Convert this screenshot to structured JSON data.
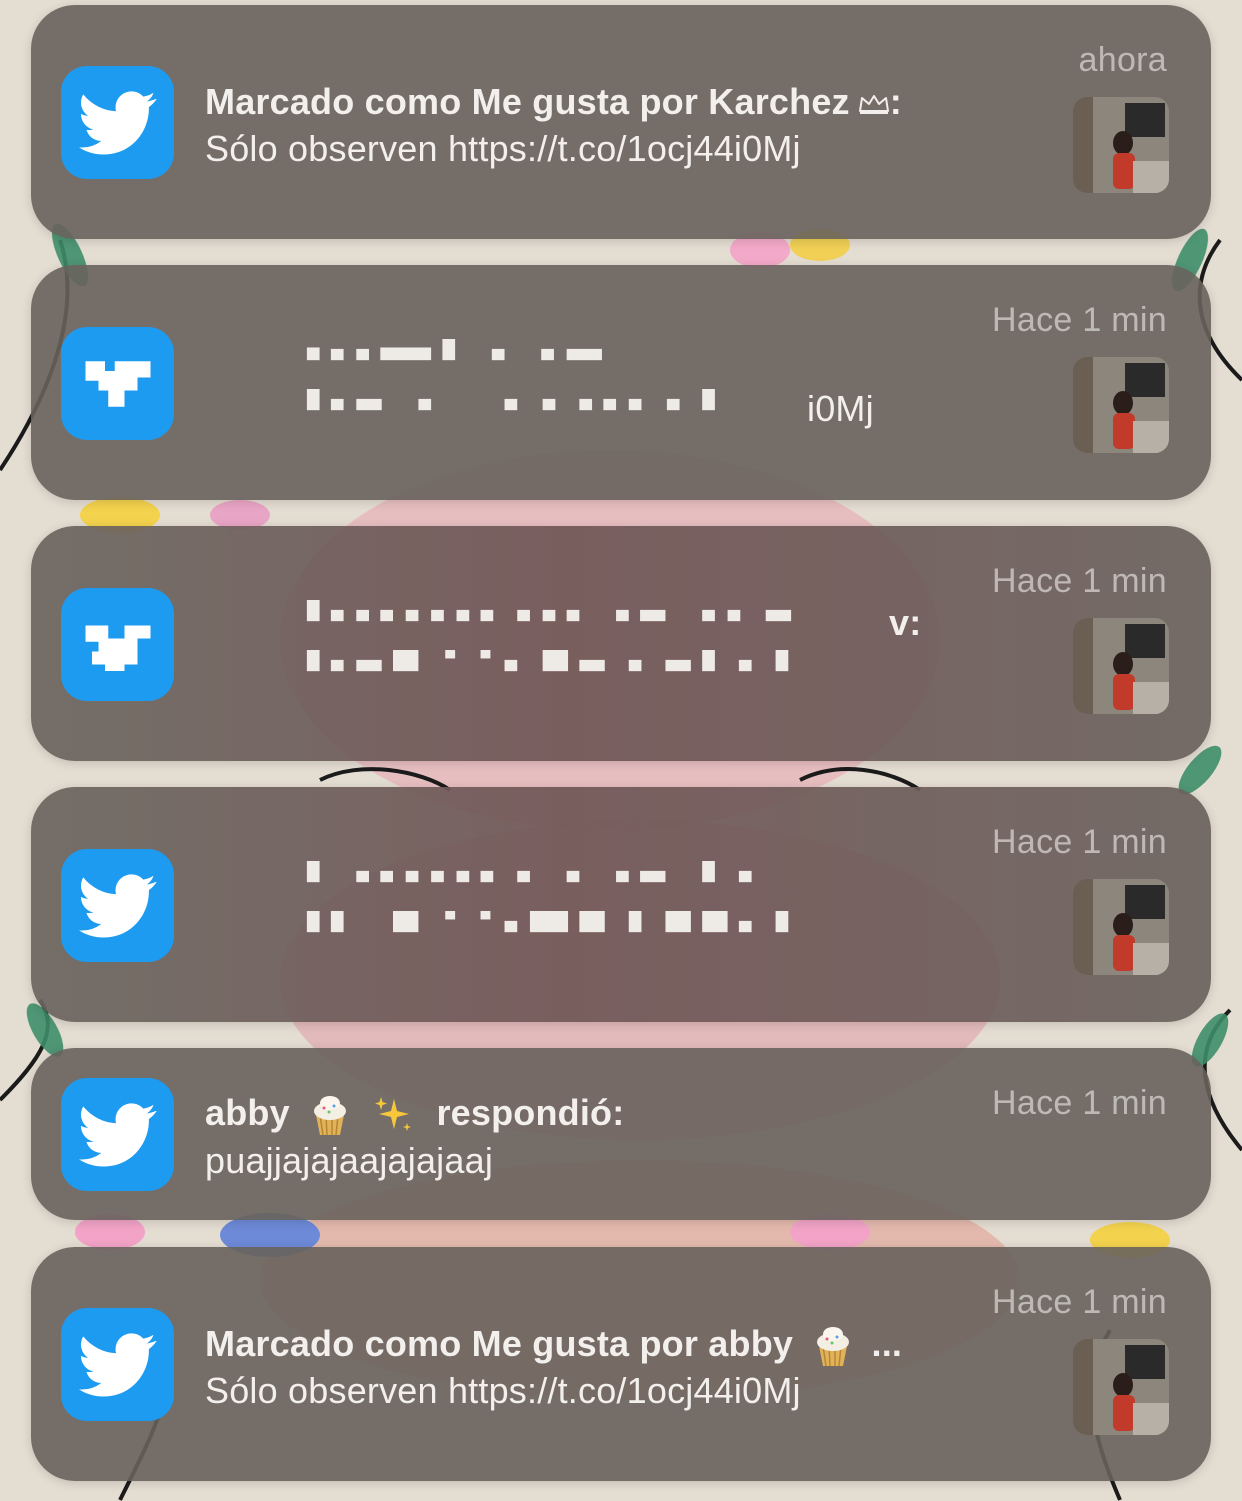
{
  "notifications": [
    {
      "time": "ahora",
      "title": "Marcado como Me gusta por Karchez",
      "title_suffix": ":",
      "body": "Sólo observen https://t.co/1ocj44i0Mj",
      "app_icon": "twitter-bird-icon",
      "has_thumbnail": true
    },
    {
      "time": "Hace 1 min",
      "body_visible_fragment": "i0Mj",
      "redacted": true,
      "app_icon": "twitter-bird-icon",
      "has_thumbnail": true
    },
    {
      "time": "Hace 1 min",
      "title_visible_fragment": "v:",
      "redacted": true,
      "app_icon": "twitter-bird-icon",
      "has_thumbnail": true
    },
    {
      "time": "Hace 1 min",
      "redacted": true,
      "app_icon": "twitter-bird-icon",
      "has_thumbnail": true
    },
    {
      "time": "Hace 1 min",
      "title_name": "abby",
      "title_action": "respondió:",
      "body": "puajjajajaajajajaaj",
      "app_icon": "twitter-bird-icon",
      "has_thumbnail": false
    },
    {
      "time": "Hace 1 min",
      "title": "Marcado como Me gusta por abby",
      "title_ellipsis": "...",
      "body": "Sólo observen https://t.co/1ocj44i0Mj",
      "app_icon": "twitter-bird-icon",
      "has_thumbnail": true
    }
  ],
  "colors": {
    "twitter_blue": "#1d9bf0",
    "card_background": "#68625c",
    "text_primary": "#f2efec",
    "text_time": "#b8b3ae"
  }
}
